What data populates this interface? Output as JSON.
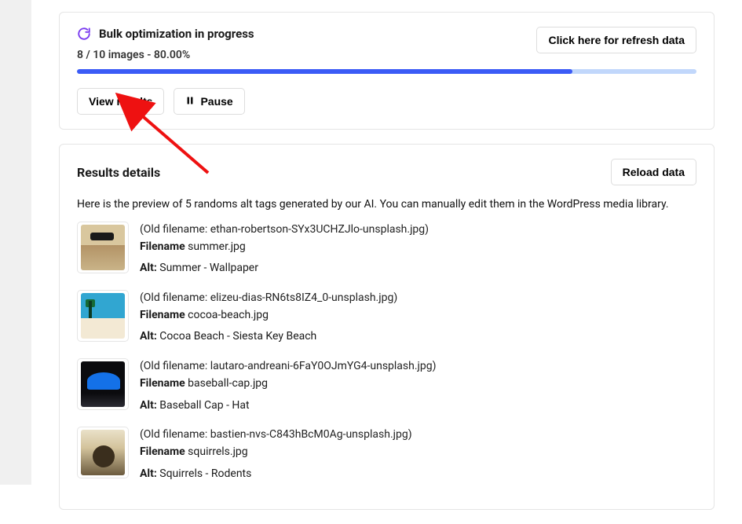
{
  "progress_card": {
    "title": "Bulk optimization in progress",
    "refresh_button": "Click here for refresh data",
    "progress_summary": "8 / 10 images - 80.00%",
    "progress_percent": 80,
    "view_results_button": "View results",
    "pause_button": "Pause"
  },
  "results_card": {
    "title": "Results details",
    "reload_button": "Reload data",
    "description": "Here is the preview of 5 randoms alt tags generated by our AI. You can manually edit them in the WordPress media library.",
    "items": [
      {
        "old_filename": "(Old filename: ethan-robertson-SYx3UCHZJlo-unsplash.jpg)",
        "filename_label": "Filename",
        "filename": "summer.jpg",
        "alt_label": "Alt:",
        "alt": "Summer - Wallpaper"
      },
      {
        "old_filename": "(Old filename: elizeu-dias-RN6ts8IZ4_0-unsplash.jpg)",
        "filename_label": "Filename",
        "filename": "cocoa-beach.jpg",
        "alt_label": "Alt:",
        "alt": "Cocoa Beach - Siesta Key Beach"
      },
      {
        "old_filename": "(Old filename: lautaro-andreani-6FaY0OJmYG4-unsplash.jpg)",
        "filename_label": "Filename",
        "filename": "baseball-cap.jpg",
        "alt_label": "Alt:",
        "alt": "Baseball Cap - Hat"
      },
      {
        "old_filename": "(Old filename: bastien-nvs-C843hBcM0Ag-unsplash.jpg)",
        "filename_label": "Filename",
        "filename": "squirrels.jpg",
        "alt_label": "Alt:",
        "alt": "Squirrels - Rodents"
      }
    ]
  }
}
